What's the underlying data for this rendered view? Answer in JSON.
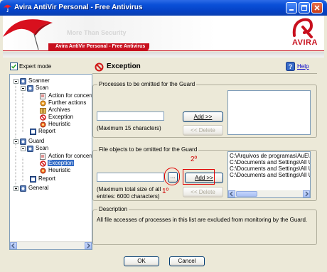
{
  "window": {
    "title": "Avira AntiVir Personal - Free Antivirus"
  },
  "banner": {
    "slogan": "More Than Security",
    "product": "Avira AntiVir Personal - Free Antivirus",
    "logo_text": "AVIRA"
  },
  "sidebar": {
    "expert_mode_label": "Expert mode",
    "expert_mode_checked": true,
    "tree": {
      "scanner": "Scanner",
      "scanner_scan": "Scan",
      "scanner_action": "Action for concerr",
      "scanner_further": "Further actions",
      "scanner_archives": "Archives",
      "scanner_exception": "Exception",
      "scanner_heuristic": "Heuristic",
      "scanner_report": "Report",
      "guard": "Guard",
      "guard_scan": "Scan",
      "guard_action": "Action for concerr",
      "guard_exception": "Exception",
      "guard_heuristic": "Heuristic",
      "guard_report": "Report",
      "general": "General"
    }
  },
  "main": {
    "title": "Exception",
    "help_label": "Help",
    "processes": {
      "legend": "Processes to be omitted for the Guard",
      "input_value": "",
      "add_label": "Add >>",
      "delete_label": "<< Delete",
      "hint": "(Maximum 15 characters)",
      "items": []
    },
    "files": {
      "legend": "File objects to be omitted for the Guard",
      "input_value": "",
      "browse_label": "...",
      "add_label": "Add >>",
      "delete_label": "<< Delete",
      "hint_line1": "(Maximum total size of all",
      "hint_line2": "entries: 6000 characters)",
      "items": [
        "C:\\Arquivos de programas\\AuE\\Ps",
        "C:\\Documents and Settings\\All Use",
        "C:\\Documents and Settings\\All Use",
        "C:\\Documents and Settings\\All Use"
      ]
    },
    "description": {
      "legend": "Description",
      "text": "All file accesses of processes in this list are excluded from monitoring by the Guard."
    },
    "annotations": {
      "first": "1º",
      "second": "2º"
    }
  },
  "footer": {
    "ok_label": "OK",
    "cancel_label": "Cancel"
  },
  "colors": {
    "avira_red": "#c8101e",
    "xp_blue": "#0542c6",
    "selection": "#316ac5",
    "annotation_red": "#e00000"
  }
}
